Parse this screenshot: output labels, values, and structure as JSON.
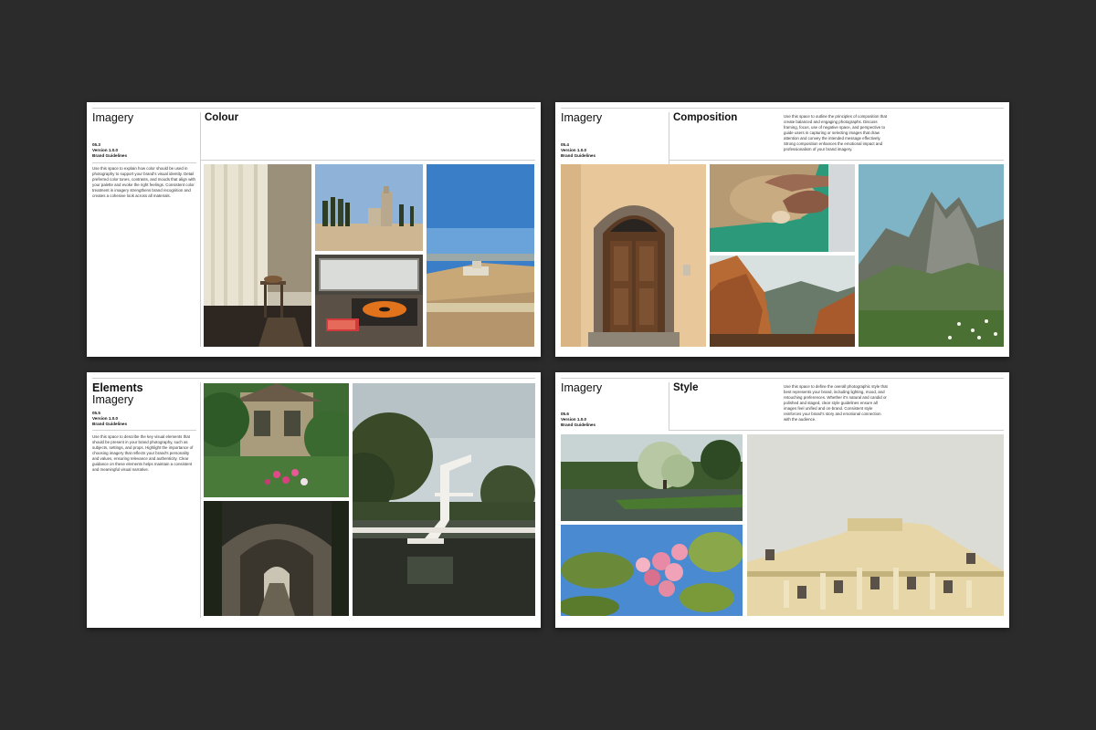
{
  "colors": {
    "background": "#2b2b2b",
    "page": "#ffffff",
    "rule": "#cfcfcf"
  },
  "pages": [
    {
      "label": "Imagery",
      "section_number": "05.3",
      "version": "Version 1.0.0",
      "doc_name": "Brand Guidelines",
      "title": "Colour",
      "description": "Use this space to explain how color should be used in photography to support your brand's visual identity. Detail preferred color tones, contrasts, and moods that align with your palette and evoke the right feelings. Consistent color treatment in imagery strengthens brand recognition and creates a cohesive look across all materials.",
      "photos": [
        "interior with curtains and stool",
        "tall cypress trees and tower",
        "record player by window",
        "blue sky over hilltop fortress"
      ]
    },
    {
      "label": "Imagery",
      "section_number": "05.4",
      "version": "Version 1.0.0",
      "doc_name": "Brand Guidelines",
      "title": "Composition",
      "description": "Use this space to outline the principles of composition that create balanced and engaging photographs. Discuss framing, focus, use of negative space, and perspective to guide users in capturing or selecting images that draw attention and convey the intended message effectively. Strong composition enhances the emotional impact and professionalism of your brand imagery.",
      "photos": [
        "arched wooden doorway",
        "hands shaping dough",
        "rocky mountain valley",
        "mountain peaks with wildflowers"
      ]
    },
    {
      "label_bold": "Elements",
      "label": "Imagery",
      "section_number": "05.5",
      "version": "Version 1.0.0",
      "doc_name": "Brand Guidelines",
      "title": "",
      "description": "Use this space to describe the key visual elements that should be present in your brand photography, such as subjects, settings, and props. Highlight the importance of choosing imagery that reflects your brand's personality and values, ensuring relevance and authenticity. Clear guidance on these elements helps maintain a consistent and meaningful visual narrative.",
      "photos": [
        "garden cottage with flowers",
        "stone archway alley",
        "diving tower over lake"
      ]
    },
    {
      "label": "Imagery",
      "section_number": "05.6",
      "version": "Version 1.0.0",
      "doc_name": "Brand Guidelines",
      "title": "Style",
      "description": "Use this space to define the overall photographic style that best represents your brand, including lighting, mood, and retouching preferences. Whether it's natural and candid or polished and staged, clear style guidelines ensure all images feel unified and on-brand. Consistent style reinforces your brand's story and emotional connection with the audience.",
      "photos": [
        "lake with blossoming tree",
        "pink cherry blossoms",
        "classical building facade"
      ]
    }
  ]
}
